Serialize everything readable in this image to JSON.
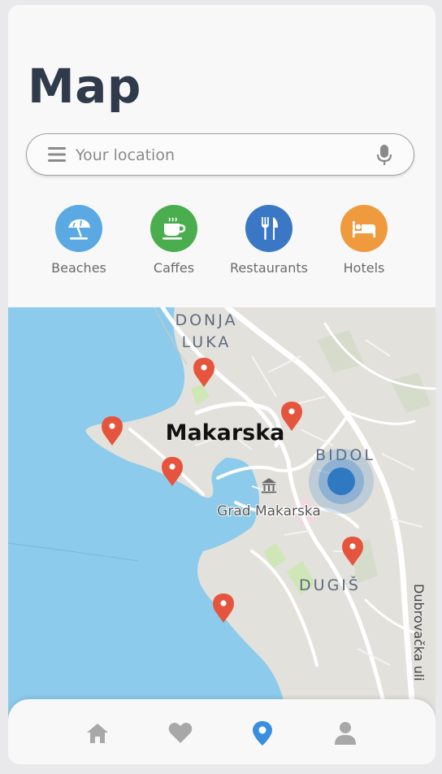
{
  "page": {
    "title": "Map"
  },
  "search": {
    "placeholder": "Your location",
    "value": ""
  },
  "categories": [
    {
      "label": "Beaches",
      "icon": "umbrella-beach-icon",
      "color": "#5aa9e3"
    },
    {
      "label": "Caffes",
      "icon": "coffee-cup-icon",
      "color": "#4aae4f"
    },
    {
      "label": "Restaurants",
      "icon": "fork-knife-icon",
      "color": "#3a78c6"
    },
    {
      "label": "Hotels",
      "icon": "bed-icon",
      "color": "#ee9a3d"
    }
  ],
  "map": {
    "labels": {
      "donja": "DONJA",
      "luka": "LUKA",
      "city": "Makarska",
      "bidol": "BIDOL",
      "grad": "Grad Makarska",
      "dugis": "DUGIŠ",
      "street": "Dubrovačka uli"
    },
    "colors": {
      "sea": "#8ccbeb",
      "land": "#e2e1dc",
      "pin": "#e5553d",
      "location": "#3b82c8"
    }
  },
  "nav": {
    "items": [
      {
        "icon": "home-icon",
        "active": false
      },
      {
        "icon": "heart-icon",
        "active": false
      },
      {
        "icon": "location-pin-icon",
        "active": true
      },
      {
        "icon": "user-icon",
        "active": false
      }
    ],
    "active_color": "#3a8ee0",
    "inactive_color": "#a8a8a8"
  }
}
